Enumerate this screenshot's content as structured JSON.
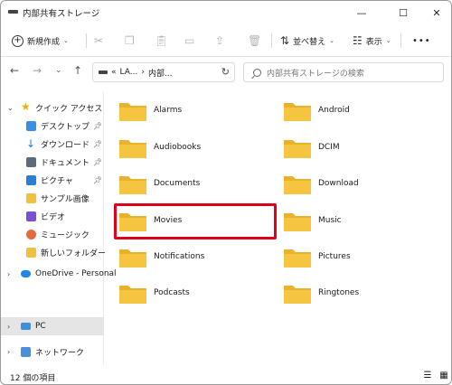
{
  "window": {
    "title": "内部共有ストレージ",
    "controls": {
      "minimize": "—",
      "maximize": "☐",
      "close": "✕"
    }
  },
  "commandbar": {
    "new_label": "新規作成",
    "sort_label": "並べ替え",
    "view_label": "表示",
    "more_label": "•••"
  },
  "address": {
    "path": [
      "«",
      "LA...",
      "›",
      "内部..."
    ],
    "search_placeholder": "内部共有ストレージの検索"
  },
  "sidebar": {
    "items": [
      {
        "label": "クイック アクセス",
        "icon": "star-icon",
        "pinned": false
      },
      {
        "label": "デスクトップ",
        "icon": "desktop-icon",
        "pinned": true
      },
      {
        "label": "ダウンロード",
        "icon": "download-icon",
        "pinned": true
      },
      {
        "label": "ドキュメント",
        "icon": "document-icon",
        "pinned": true
      },
      {
        "label": "ピクチャ",
        "icon": "pictures-icon",
        "pinned": true
      },
      {
        "label": "サンプル画像",
        "icon": "folder-icon",
        "pinned": false
      },
      {
        "label": "ビデオ",
        "icon": "video-icon",
        "pinned": false
      },
      {
        "label": "ミュージック",
        "icon": "music-icon",
        "pinned": false
      },
      {
        "label": "新しいフォルダー",
        "icon": "folder-icon",
        "pinned": false
      },
      {
        "label": "OneDrive - Personal",
        "icon": "cloud-icon",
        "pinned": false
      },
      {
        "label": "PC",
        "icon": "pc-icon",
        "pinned": false
      },
      {
        "label": "ネットワーク",
        "icon": "network-icon",
        "pinned": false
      }
    ],
    "selected": "PC"
  },
  "folders": {
    "left": [
      "Alarms",
      "Audiobooks",
      "Documents",
      "Movies",
      "Notifications",
      "Podcasts"
    ],
    "right": [
      "Android",
      "DCIM",
      "Download",
      "Music",
      "Pictures",
      "Ringtones"
    ],
    "highlighted": "Movies"
  },
  "status": {
    "count_text": "12 個の項目"
  },
  "colors": {
    "folder": "#f5c542",
    "folder_back": "#e8b22c",
    "highlight": "#e0001a",
    "selected_bg": "#e5e5e5"
  }
}
